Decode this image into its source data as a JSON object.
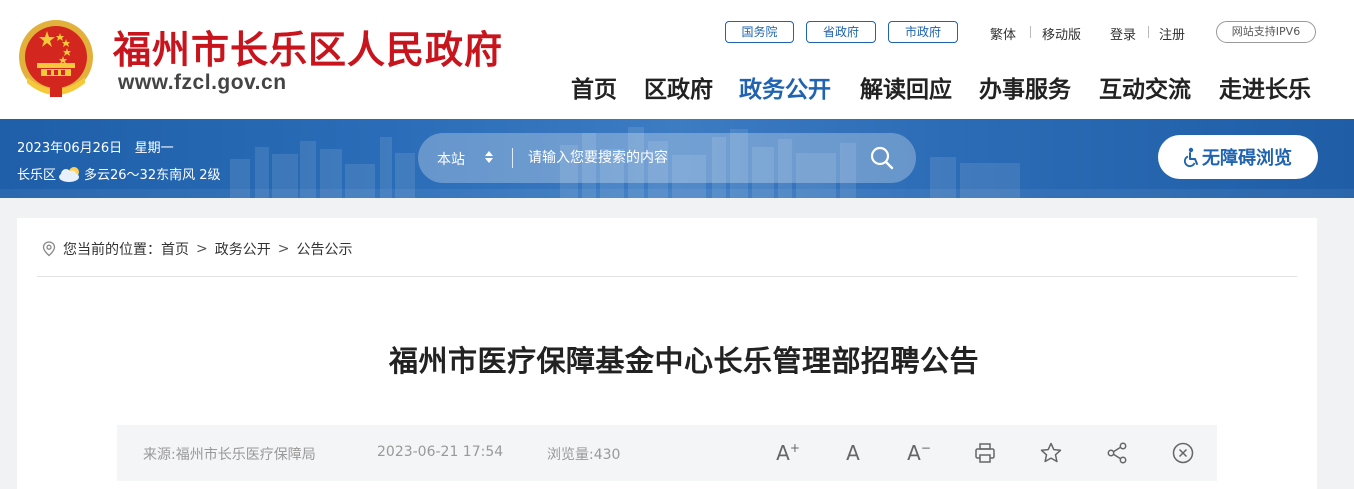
{
  "header": {
    "site_name": "福州市长乐区人民政府",
    "site_url": "www.fzcl.gov.cn",
    "top_links": [
      "国务院",
      "省政府",
      "市政府"
    ],
    "fanti": "繁体",
    "mobile": "移动版",
    "login": "登录",
    "register": "注册",
    "ipv6": "网站支持IPV6",
    "nav": [
      "首页",
      "区政府",
      "政务公开",
      "解读回应",
      "办事服务",
      "互动交流",
      "走进长乐"
    ],
    "nav_active": "政务公开",
    "emblem_icon": "national-emblem-icon"
  },
  "banner": {
    "date": "2023年06月26日",
    "weekday": "星期一",
    "region": "长乐区",
    "weather": "多云26～32东南风 2级",
    "search_scope": "本站",
    "search_placeholder": "请输入您要搜索的内容",
    "accessibility": "无障碍浏览"
  },
  "breadcrumb": {
    "prefix": "您当前的位置：",
    "items": [
      "首页",
      "政务公开",
      "公告公示"
    ]
  },
  "article": {
    "title": "福州市医疗保障基金中心长乐管理部招聘公告",
    "source": "来源:福州市长乐医疗保障局",
    "datetime": "2023-06-21 17:54",
    "views": "浏览量:430"
  },
  "tools": {
    "font_larger": "A",
    "font_normal": "A",
    "font_smaller": "A"
  },
  "colors": {
    "brand_red": "#c8151d",
    "brand_blue": "#1f63b1",
    "banner_blue": "#2b6db8"
  }
}
